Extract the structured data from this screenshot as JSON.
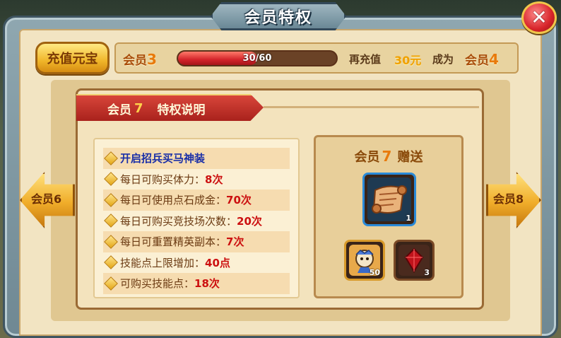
{
  "dialog": {
    "title": "会员特权",
    "close_symbol": "✕"
  },
  "topbar": {
    "recharge_label": "充值元宝",
    "current_vip_label": "会员",
    "current_vip_level": "3",
    "progress_text": "30/60",
    "progress_fraction": 0.5,
    "recharge_prefix": "再充值",
    "recharge_amount": "30元",
    "become_text": "成为",
    "next_vip_label": "会员",
    "next_vip_level": "4"
  },
  "section": {
    "vip_label": "会员",
    "vip_level": "7",
    "title": "特权说明"
  },
  "privileges": [
    {
      "text": "开启招兵买马神装",
      "value": "",
      "highlight": true
    },
    {
      "text": "每日可购买体力：",
      "value": "8次",
      "highlight": false
    },
    {
      "text": "每日可使用点石成金：",
      "value": "70次",
      "highlight": false
    },
    {
      "text": "每日可购买竞技场次数：",
      "value": "20次",
      "highlight": false
    },
    {
      "text": "每日可重置精英副本：",
      "value": "7次",
      "highlight": false
    },
    {
      "text": "技能点上限增加：",
      "value": "40点",
      "highlight": false
    },
    {
      "text": "可购买技能点：",
      "value": "18次",
      "highlight": false
    }
  ],
  "gift": {
    "vip_label": "会员",
    "vip_level": "7",
    "title": "赠送",
    "items": [
      {
        "icon": "scroll-icon",
        "count": "1"
      },
      {
        "icon": "hero-card-icon",
        "count": "50"
      },
      {
        "icon": "red-gem-icon",
        "count": "3"
      }
    ]
  },
  "nav": {
    "prev_label": "会员6",
    "next_label": "会员8"
  }
}
